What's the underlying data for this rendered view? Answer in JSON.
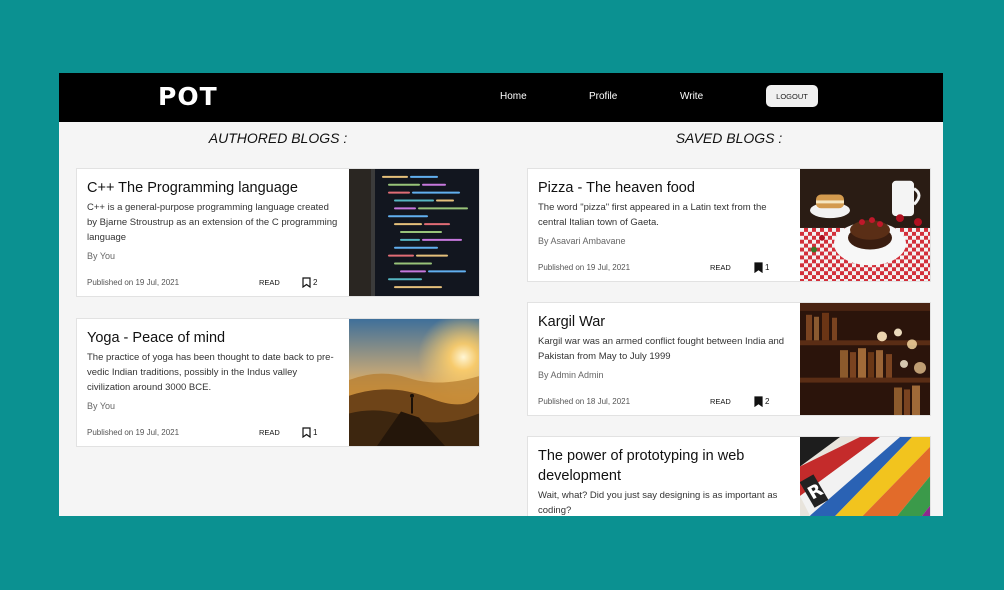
{
  "nav": {
    "logo": "POT",
    "links": [
      "Home",
      "Profile",
      "Write"
    ],
    "logout": "LOGOUT"
  },
  "authored": {
    "title": "AUTHORED BLOGS :",
    "cards": [
      {
        "title": "C++ The Programming language",
        "desc": "C++ is a general-purpose programming language created by Bjarne Stroustrup as an extension of the C programming language",
        "author": "By You",
        "date": "Published on 19 Jul, 2021",
        "read": "READ",
        "saves": "2",
        "image": "code-screen"
      },
      {
        "title": "Yoga - Peace of mind",
        "desc": "The practice of yoga has been thought to date back to pre-vedic Indian traditions, possibly in the Indus valley civilization around 3000 BCE.",
        "author": "By You",
        "date": "Published on 19 Jul, 2021",
        "read": "READ",
        "saves": "1",
        "image": "mountain-sunset"
      }
    ]
  },
  "saved": {
    "title": "SAVED BLOGS :",
    "cards": [
      {
        "title": "Pizza - The heaven food",
        "desc": "The word \"pizza\" first appeared in a Latin text from the central Italian town of Gaeta.",
        "author": "By Asavari Ambavane",
        "date": "Published on 19 Jul, 2021",
        "read": "READ",
        "saves": "1",
        "image": "pancakes"
      },
      {
        "title": "Kargil War",
        "desc": "Kargil war was an armed conflict fought between India and Pakistan from May to July 1999",
        "author": "By Admin Admin",
        "date": "Published on 18 Jul, 2021",
        "read": "READ",
        "saves": "2",
        "image": "bookshelf"
      },
      {
        "title": "The power of prototyping in web development",
        "desc": "Wait, what? Did you just say designing is as important as coding?",
        "author": "",
        "date": "",
        "read": "",
        "saves": "",
        "image": "color-swatches"
      }
    ]
  }
}
